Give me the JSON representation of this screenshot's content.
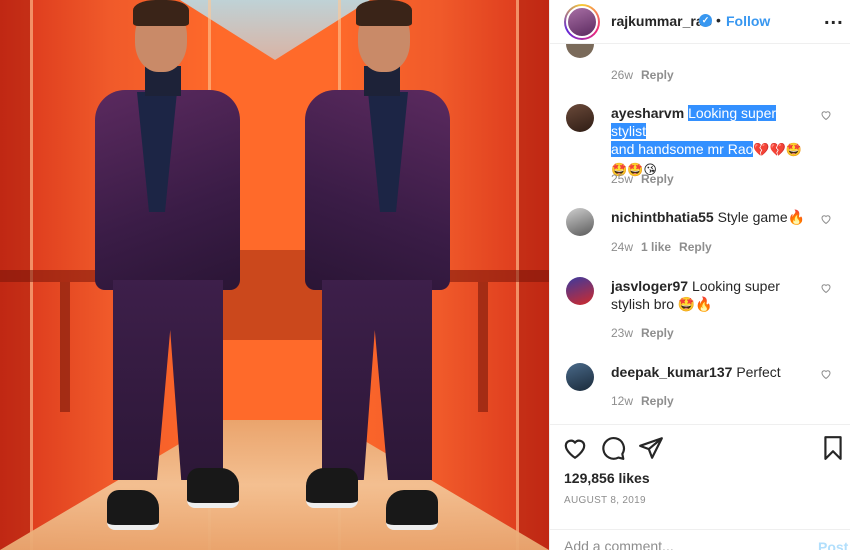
{
  "header": {
    "username": "rajkummar_rao",
    "verified_icon": "verified-badge-icon",
    "separator": "•",
    "follow_label": "Follow",
    "more_label": "..."
  },
  "previous_comment": {
    "time": "26w",
    "reply_label": "Reply"
  },
  "comments": [
    {
      "username": "ayesharvm",
      "text_highlighted_1": "Looking super stylist",
      "text_highlighted_2": "and handsome mr Rao",
      "emoji_line_1": "💔💔🤩",
      "emoji_line_2": "🤩🤩😘",
      "time": "25w",
      "reply_label": "Reply"
    },
    {
      "username": "nichintbhatia55",
      "text": "Style game🔥",
      "time": "24w",
      "likes": "1 like",
      "reply_label": "Reply"
    },
    {
      "username": "jasvloger97",
      "text": "Looking super stylish bro 🤩🔥",
      "time": "23w",
      "reply_label": "Reply"
    },
    {
      "username": "deepak_kumar137",
      "text": "Perfect",
      "time": "12w",
      "reply_label": "Reply"
    }
  ],
  "post": {
    "likes": "129,856 likes",
    "date": "AUGUST 8, 2019"
  },
  "add_comment": {
    "placeholder": "Add a comment...",
    "post_label": "Post"
  },
  "colors": {
    "link_blue": "#3897f0",
    "post_disabled": "#b2dffc",
    "muted": "#8e8e8e",
    "highlight": "#3390ff"
  }
}
